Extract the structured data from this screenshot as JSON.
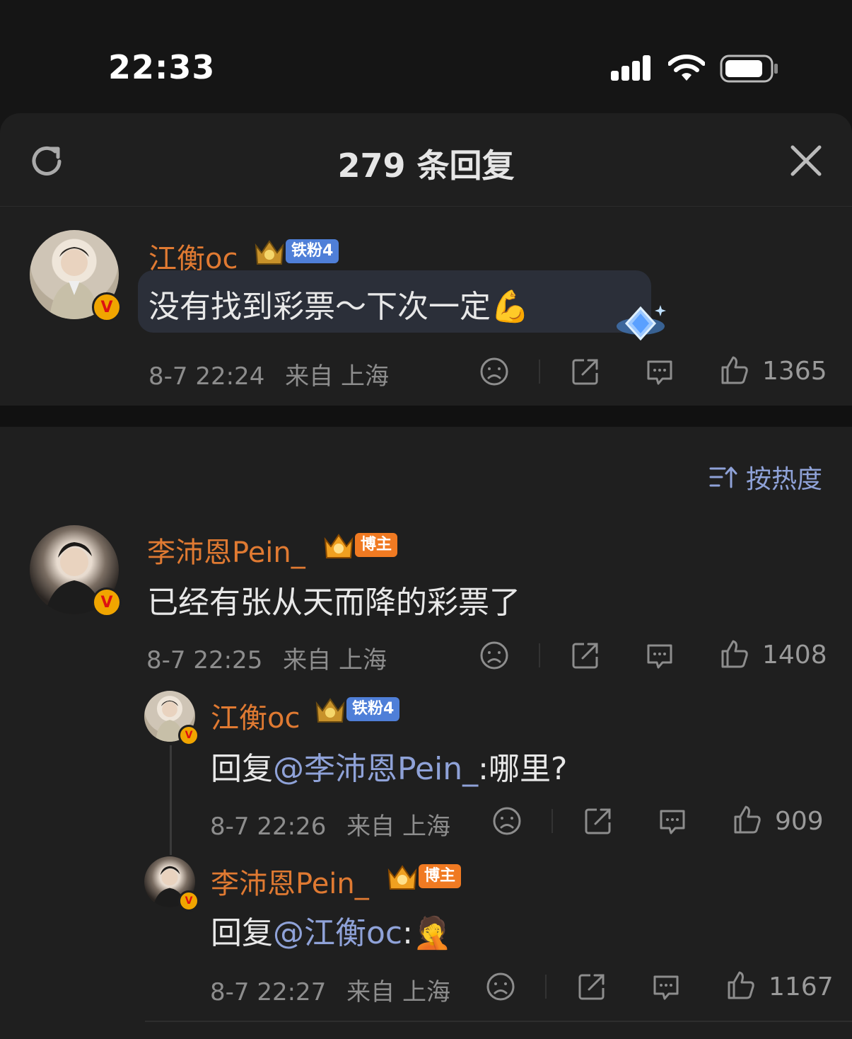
{
  "status": {
    "time": "22:33"
  },
  "header": {
    "title": "279 条回复"
  },
  "main_comment": {
    "username": "江衡oc",
    "tag": "铁粉4",
    "text": "没有找到彩票～下次一定",
    "emoji": "💪",
    "time": "8-7 22:24",
    "location": "来自 上海",
    "likes": "1365"
  },
  "sort": {
    "label": "按热度"
  },
  "replies": [
    {
      "username": "李沛恩Pein_",
      "tag": "博主",
      "text": "已经有张从天而降的彩票了",
      "time": "8-7 22:25",
      "location": "来自 上海",
      "likes": "1408"
    },
    {
      "username": "江衡oc",
      "tag": "铁粉4",
      "prefix": "回复",
      "mention": "@李沛恩Pein_",
      "text": ":哪里?",
      "time": "8-7 22:26",
      "location": "来自 上海",
      "likes": "909"
    },
    {
      "username": "李沛恩Pein_",
      "tag": "博主",
      "prefix": "回复",
      "mention": "@江衡oc",
      "text": ":",
      "emoji": "🤦",
      "time": "8-7 22:27",
      "location": "来自 上海",
      "likes": "1167"
    }
  ],
  "icons": [
    "refresh-icon",
    "close-icon",
    "dislike-icon",
    "share-icon",
    "comment-icon",
    "like-icon",
    "sort-icon",
    "verified-icon",
    "crown-icon"
  ]
}
